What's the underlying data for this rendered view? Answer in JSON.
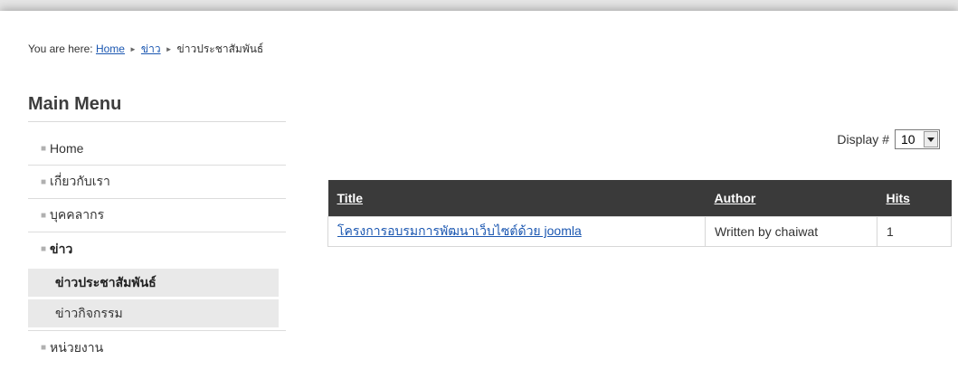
{
  "breadcrumb": {
    "prefix": "You are here:",
    "items": [
      "Home",
      "ข่าว",
      "ข่าวประชาสัมพันธ์"
    ],
    "separator": "►"
  },
  "menu": {
    "title": "Main Menu",
    "bullet": "■",
    "items": [
      {
        "label": "Home"
      },
      {
        "label": "เกี่ยวกับเรา"
      },
      {
        "label": "บุคคลากร"
      },
      {
        "label": "ข่าว"
      },
      {
        "label": "หน่วยงาน"
      }
    ],
    "subitems": [
      {
        "label": "ข่าวประชาสัมพันธ์"
      },
      {
        "label": "ข่าวกิจกรรม"
      }
    ]
  },
  "display": {
    "label": "Display #",
    "value": "10"
  },
  "table": {
    "headers": [
      "Title",
      "Author",
      "Hits"
    ],
    "rows": [
      {
        "title": "โครงการอบรมการพัฒนาเว็บไซต์ด้วย joomla",
        "author": "Written by chaiwat",
        "hits": "1"
      }
    ]
  },
  "colors": {
    "link": "#1b57b1",
    "header_bg": "#3a3a3a",
    "submenu_bg": "#e9e9e9"
  }
}
